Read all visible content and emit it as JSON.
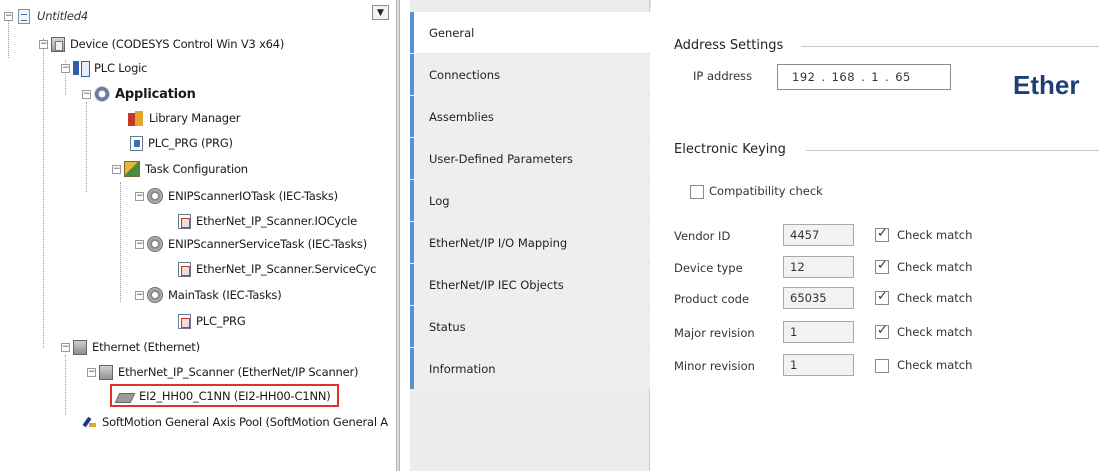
{
  "tree": {
    "root": "Untitled4",
    "device": "Device (CODESYS Control Win V3 x64)",
    "plc_logic": "PLC Logic",
    "application": "Application",
    "library_manager": "Library Manager",
    "plc_prg": "PLC_PRG (PRG)",
    "task_configuration": "Task Configuration",
    "enip_io_task": "ENIPScannerIOTask (IEC-Tasks)",
    "io_cycle": "EtherNet_IP_Scanner.IOCycle",
    "enip_service_task": "ENIPScannerServiceTask (IEC-Tasks)",
    "service_cycle": "EtherNet_IP_Scanner.ServiceCyc",
    "main_task": "MainTask (IEC-Tasks)",
    "plc_prg_call": "PLC_PRG",
    "ethernet": "Ethernet (Ethernet)",
    "scanner": "EtherNet_IP_Scanner (EtherNet/IP Scanner)",
    "adapter": "EI2_HH00_C1NN (EI2-HH00-C1NN)",
    "softmotion": "SoftMotion General Axis Pool (SoftMotion General A"
  },
  "tabs": [
    {
      "label": "General",
      "active": true
    },
    {
      "label": "Connections",
      "active": false
    },
    {
      "label": "Assemblies",
      "active": false
    },
    {
      "label": "User-Defined Parameters",
      "active": false
    },
    {
      "label": "Log",
      "active": false
    },
    {
      "label": "EtherNet/IP I/O Mapping",
      "active": false
    },
    {
      "label": "EtherNet/IP IEC Objects",
      "active": false
    },
    {
      "label": "Status",
      "active": false
    },
    {
      "label": "Information",
      "active": false
    }
  ],
  "address_settings": {
    "title": "Address Settings",
    "ip_label": "IP address",
    "ip": [
      "192",
      "168",
      "1",
      "65"
    ],
    "logo_text": "Ether"
  },
  "electronic_keying": {
    "title": "Electronic Keying",
    "compat_label": "Compatibility check",
    "compat_checked": false,
    "rows": [
      {
        "label": "Vendor ID",
        "value": "4457",
        "check_label": "Check match",
        "checked": true
      },
      {
        "label": "Device type",
        "value": "12",
        "check_label": "Check match",
        "checked": true
      },
      {
        "label": "Product code",
        "value": "65035",
        "check_label": "Check match",
        "checked": true
      },
      {
        "label": "Major revision",
        "value": "1",
        "check_label": "Check match",
        "checked": true
      },
      {
        "label": "Minor revision",
        "value": "1",
        "check_label": "Check match",
        "checked": false
      }
    ]
  },
  "colors": {
    "accent_tab": "#5b8fd0",
    "selection_border": "#e2302a",
    "logo": "#1c3f75"
  }
}
